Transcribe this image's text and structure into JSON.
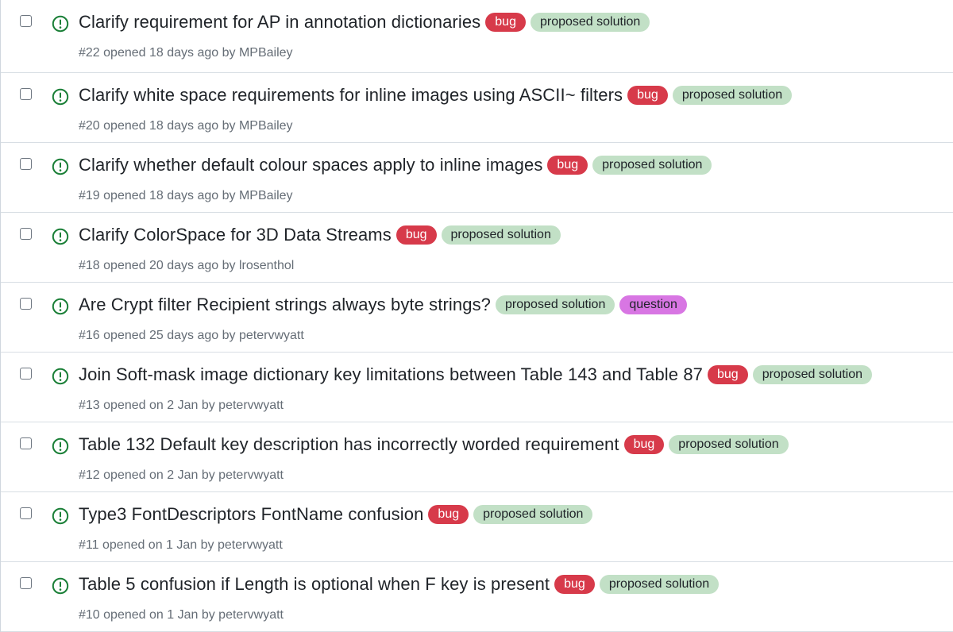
{
  "labels": {
    "bug": {
      "text": "bug",
      "bg": "#d73a4a",
      "fg": "#ffffff"
    },
    "proposed solution": {
      "text": "proposed solution",
      "bg": "#c2e0c6",
      "fg": "#1f2328"
    },
    "question": {
      "text": "question",
      "bg": "#d876e3",
      "fg": "#1f2328"
    }
  },
  "colors": {
    "open_icon": "#1a7f37",
    "meta_text": "#656d76",
    "title_text": "#1f2328"
  },
  "issues": [
    {
      "title": "Clarify requirement for AP in annotation dictionaries",
      "labels": [
        "bug",
        "proposed solution"
      ],
      "number": "#22",
      "opened_text": "opened 18 days ago by",
      "author": "MPBailey"
    },
    {
      "title": "Clarify white space requirements for inline images using ASCII~ filters",
      "labels": [
        "bug",
        "proposed solution"
      ],
      "number": "#20",
      "opened_text": "opened 18 days ago by",
      "author": "MPBailey"
    },
    {
      "title": "Clarify whether default colour spaces apply to inline images",
      "labels": [
        "bug",
        "proposed solution"
      ],
      "number": "#19",
      "opened_text": "opened 18 days ago by",
      "author": "MPBailey"
    },
    {
      "title": "Clarify ColorSpace for 3D Data Streams",
      "labels": [
        "bug",
        "proposed solution"
      ],
      "number": "#18",
      "opened_text": "opened 20 days ago by",
      "author": "lrosenthol"
    },
    {
      "title": "Are Crypt filter Recipient strings always byte strings?",
      "labels": [
        "proposed solution",
        "question"
      ],
      "number": "#16",
      "opened_text": "opened 25 days ago by",
      "author": "petervwyatt"
    },
    {
      "title": "Join Soft-mask image dictionary key limitations between Table 143 and Table 87",
      "labels": [
        "bug",
        "proposed solution"
      ],
      "number": "#13",
      "opened_text": "opened on 2 Jan by",
      "author": "petervwyatt"
    },
    {
      "title": "Table 132 Default key description has incorrectly worded requirement",
      "labels": [
        "bug",
        "proposed solution"
      ],
      "number": "#12",
      "opened_text": "opened on 2 Jan by",
      "author": "petervwyatt"
    },
    {
      "title": "Type3 FontDescriptors FontName confusion",
      "labels": [
        "bug",
        "proposed solution"
      ],
      "number": "#11",
      "opened_text": "opened on 1 Jan by",
      "author": "petervwyatt"
    },
    {
      "title": "Table 5 confusion if Length is optional when F key is present",
      "labels": [
        "bug",
        "proposed solution"
      ],
      "number": "#10",
      "opened_text": "opened on 1 Jan by",
      "author": "petervwyatt"
    }
  ]
}
